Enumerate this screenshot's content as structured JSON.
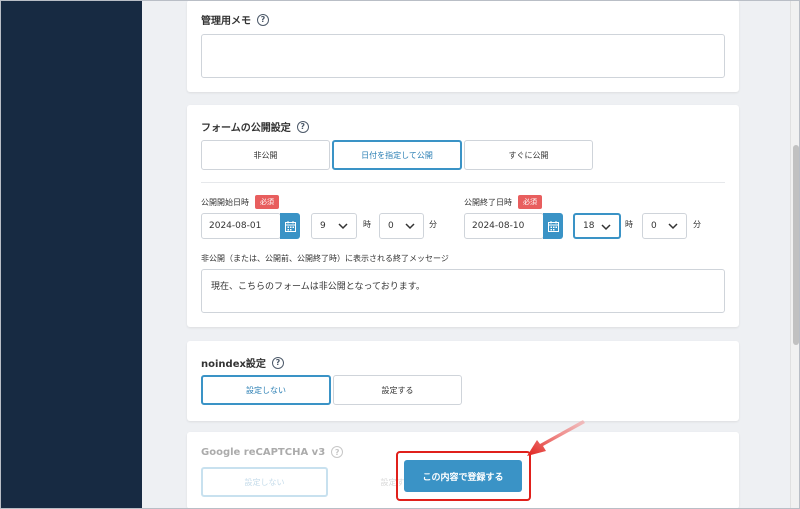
{
  "memo": {
    "title": "管理用メモ",
    "value": ""
  },
  "publish": {
    "title": "フォームの公開設定",
    "options": [
      "非公開",
      "日付を指定して公開",
      "すぐに公開"
    ],
    "start": {
      "label": "公開開始日時",
      "required": "必須",
      "date": "2024-08-01",
      "hour": "9",
      "minute": "0"
    },
    "end": {
      "label": "公開終了日時",
      "required": "必須",
      "date": "2024-08-10",
      "hour": "18",
      "minute": "0"
    },
    "hour_unit": "時",
    "minute_unit": "分",
    "message_label": "非公開（または、公開前、公開終了時）に表示される終了メッセージ",
    "message_value": "現在、こちらのフォームは非公開となっております。"
  },
  "noindex": {
    "title": "noindex設定",
    "options": [
      "設定しない",
      "設定する"
    ]
  },
  "recaptcha": {
    "title": "Google reCAPTCHA v3",
    "options": [
      "設定しない",
      "設定する"
    ]
  },
  "submit_label": "この内容で登録する",
  "colors": {
    "accent": "#3a93c6",
    "sidebar": "#172a42",
    "required": "#e85e5e",
    "highlight": "#e0201b"
  }
}
